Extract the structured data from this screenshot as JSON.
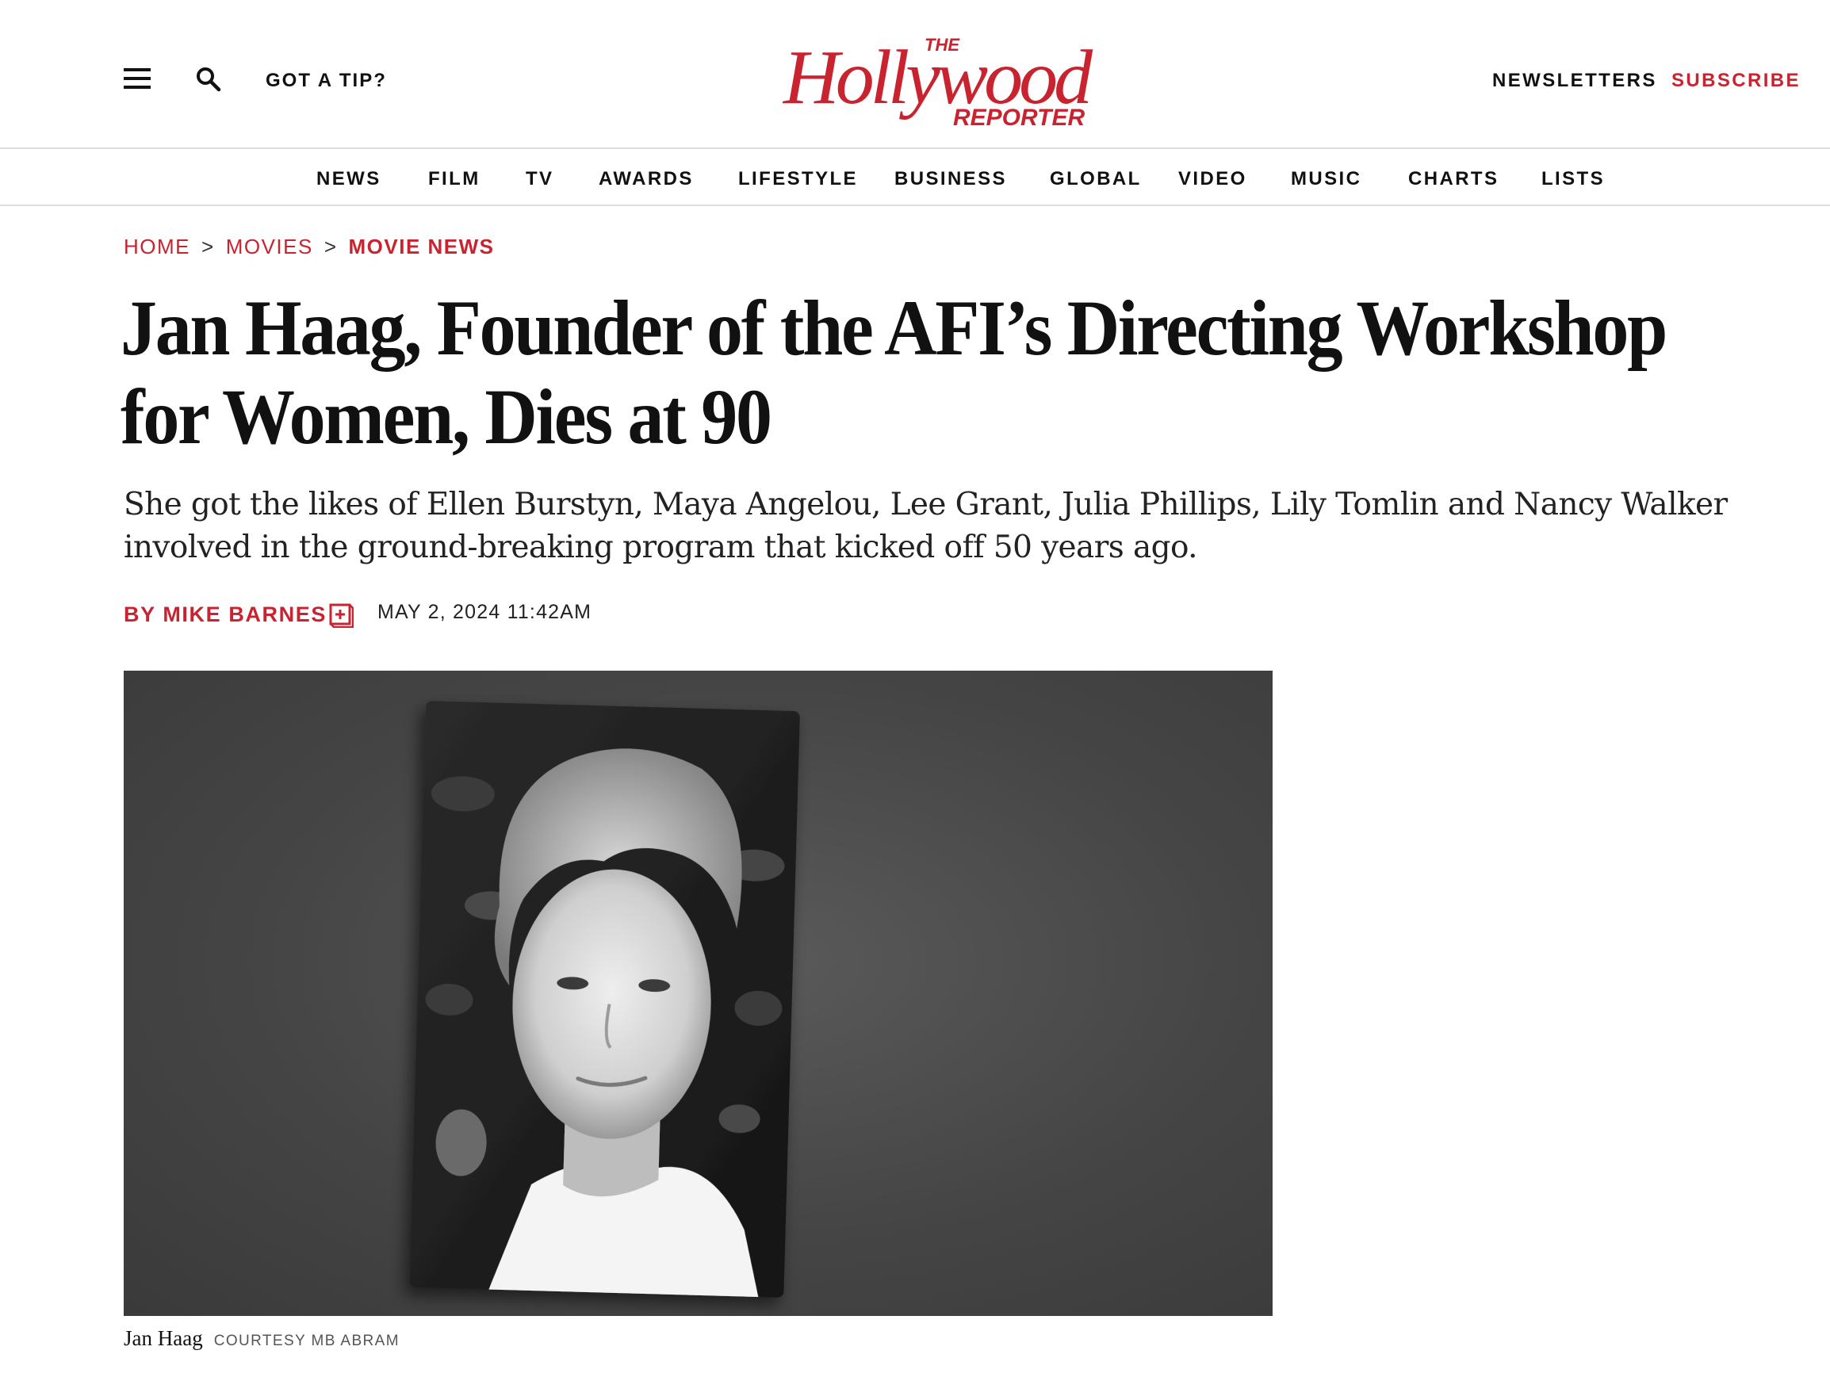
{
  "header": {
    "tip_label": "GOT A TIP?",
    "logo": {
      "the": "THE",
      "hollywood": "Hollywood",
      "reporter": "REPORTER"
    },
    "newsletters_label": "NEWSLETTERS",
    "subscribe_label": "SUBSCRIBE"
  },
  "nav": {
    "items": [
      {
        "label": "NEWS"
      },
      {
        "label": "FILM"
      },
      {
        "label": "TV"
      },
      {
        "label": "AWARDS"
      },
      {
        "label": "LIFESTYLE"
      },
      {
        "label": "BUSINESS"
      },
      {
        "label": "GLOBAL"
      },
      {
        "label": "VIDEO"
      },
      {
        "label": "MUSIC"
      },
      {
        "label": "CHARTS"
      },
      {
        "label": "LISTS"
      }
    ]
  },
  "breadcrumb": {
    "items": [
      "HOME",
      "MOVIES",
      "MOVIE NEWS"
    ],
    "separator": ">"
  },
  "article": {
    "headline_line1": "Jan Haag, Founder of the AFI’s Directing Workshop",
    "headline_line2": "for Women, Dies at 90",
    "dek_line1": "She got the likes of Ellen Burstyn, Maya Angelou, Lee Grant, Julia Phillips, Lily Tomlin and Nancy Walker",
    "dek_line2": "involved in the ground-breaking program that kicked off 50 years ago.",
    "byline": "BY MIKE BARNES",
    "date": "MAY 2, 2024 11:42AM",
    "image_caption": "Jan Haag",
    "image_credit": "COURTESY MB ABRAM"
  },
  "colors": {
    "brand_red": "#c8232f",
    "text": "#111111",
    "rule": "#dddddd"
  }
}
